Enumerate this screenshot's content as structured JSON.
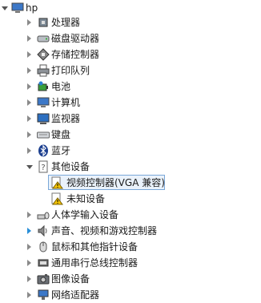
{
  "tree": {
    "root": {
      "label": "hp",
      "icon": "computer-icon"
    },
    "categories": [
      {
        "label": "处理器",
        "icon": "processor-icon",
        "expander": "collapsed"
      },
      {
        "label": "磁盘驱动器",
        "icon": "disk-drive-icon",
        "expander": "collapsed"
      },
      {
        "label": "存储控制器",
        "icon": "storage-controller-icon",
        "expander": "collapsed"
      },
      {
        "label": "打印队列",
        "icon": "printer-icon",
        "expander": "collapsed"
      },
      {
        "label": "电池",
        "icon": "battery-icon",
        "expander": "collapsed"
      },
      {
        "label": "计算机",
        "icon": "computer-icon",
        "expander": "collapsed"
      },
      {
        "label": "监视器",
        "icon": "monitor-icon",
        "expander": "collapsed"
      },
      {
        "label": "键盘",
        "icon": "keyboard-icon",
        "expander": "collapsed"
      },
      {
        "label": "蓝牙",
        "icon": "bluetooth-icon",
        "expander": "collapsed"
      },
      {
        "label": "其他设备",
        "icon": "other-devices-icon",
        "expander": "expanded"
      },
      {
        "label": "人体学输入设备",
        "icon": "hid-icon",
        "expander": "collapsed"
      },
      {
        "label": "声音、视频和游戏控制器",
        "icon": "sound-icon",
        "expander": "collapsed"
      },
      {
        "label": "鼠标和其他指针设备",
        "icon": "mouse-icon",
        "expander": "collapsed"
      },
      {
        "label": "通用串行总线控制器",
        "icon": "usb-icon",
        "expander": "collapsed"
      },
      {
        "label": "图像设备",
        "icon": "camera-icon",
        "expander": "collapsed"
      },
      {
        "label": "网络适配器",
        "icon": "network-icon",
        "expander": "collapsed"
      }
    ],
    "other_devices_children": [
      {
        "label": "视频控制器(VGA 兼容)",
        "icon": "warning-device-icon",
        "selected": true
      },
      {
        "label": "未知设备",
        "icon": "warning-device-icon",
        "selected": false
      }
    ]
  }
}
